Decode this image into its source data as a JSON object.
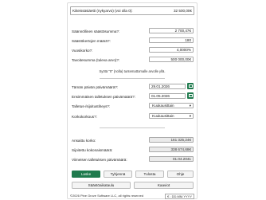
{
  "form": {
    "start_balance": {
      "label": "Kiiteissäsiäetti (nykyarvo) (voi olla 0):",
      "value": "32 500,00€"
    },
    "monthly_savings": {
      "label": "Säännöllinen säästösumma?:",
      "value": "2 700,47€"
    },
    "saving_count": {
      "label": "Säästökertojen määrä?:",
      "value": "180"
    },
    "annual_interest": {
      "label": "Vuosikorko?:",
      "value": "4,0000%"
    },
    "target_savings": {
      "label": "Tavoitesumma (tuleva arvo)?:",
      "value": "500 000,00€"
    },
    "note": "Syötä \"0\" (nolla) tuntemattomalle arvolle yllä.",
    "today": {
      "label": "Tämän päivän päivämäärä?:",
      "value": "29.01.2026"
    },
    "first_deposit": {
      "label": "Ensimmäisen talletuksen päivämäärä?:",
      "value": "01.05.2026"
    },
    "deposit_frequency": {
      "label": "Talletus-/sijoitustiheys?:",
      "value": "Kuukausittain"
    },
    "interest_frequency": {
      "label": "Korkokorkous?:",
      "value": "Kuukausittain"
    }
  },
  "results": {
    "interest": {
      "label": "Ansaittu korko:",
      "value": "161 325,24€"
    },
    "total_invested": {
      "label": "Sijoitettu kokonaismäärä:",
      "value": "338 674,68€"
    },
    "last_deposit": {
      "label": "Viimeisen talletuksen päivämäärä:",
      "value": "01.04.2041"
    }
  },
  "buttons": {
    "calculate": "Laske",
    "clear": "Tyhjennä",
    "print": "Tulosta",
    "help": "Ohje",
    "schedule": "Säästöaikataulu",
    "graph": "Kaaviot"
  },
  "footer": {
    "copyright": "©2026 Pine Grove Software LLC, all rights reserved",
    "format": "€ : DD.MM.YYYY"
  },
  "colors": {
    "accent": "#1f7a4d"
  }
}
